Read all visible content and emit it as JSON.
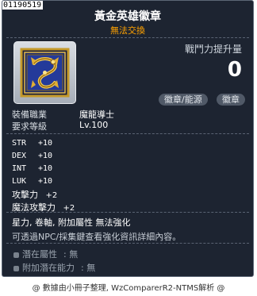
{
  "item": {
    "id": "01190519",
    "name": "黃金英雄徽章",
    "subtitle": "無法交換",
    "icon": "golden-dragon-emblem"
  },
  "power": {
    "label": "戰鬥力提升量",
    "value": "0"
  },
  "tags": [
    "徽章/能源",
    "徽章"
  ],
  "requirements": {
    "job_label": "裝備職業",
    "job_value": "魔龍導士",
    "level_label": "要求等級",
    "level_value": "Lv.100"
  },
  "stats": [
    {
      "name": "STR",
      "value": "+10"
    },
    {
      "name": "DEX",
      "value": "+10"
    },
    {
      "name": "INT",
      "value": "+10"
    },
    {
      "name": "LUK",
      "value": "+10"
    },
    {
      "name": "攻擊力",
      "value": "+2"
    },
    {
      "name": "魔法攻擊力",
      "value": "+2"
    }
  ],
  "description": {
    "line1": "星力, 卷軸, 附加屬性 無法強化",
    "line2": "可透過NPC/採集鍵查看強化資訊詳細內容。"
  },
  "potential": [
    {
      "label": "潛在屬性",
      "value": ": 無"
    },
    {
      "label": "附加潛在能力",
      "value": ": 無"
    }
  ],
  "footer": "@ 數據由小冊子整理, WzComparerR2-NTMS解析 @",
  "colors": {
    "background": "#1d2431",
    "subtitle": "#ffa200",
    "border": "#5d6776"
  }
}
